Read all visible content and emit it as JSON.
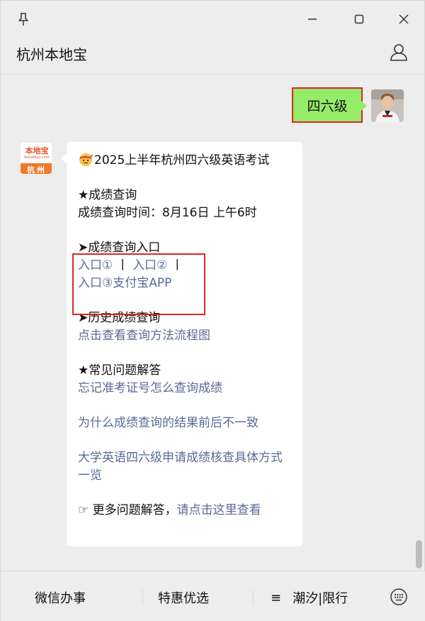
{
  "window": {
    "title": "杭州本地宝"
  },
  "header": {
    "title": "杭州本地宝",
    "profile_icon": "person-icon"
  },
  "chat": {
    "sent_message": "四六级",
    "bot_avatar": {
      "logo_text": "本地宝",
      "logo_url": "bendibao.com",
      "city": "杭州"
    },
    "reply": {
      "title_emoji": "face-with-headband-emoji",
      "title": "2025上半年杭州四六级英语考试",
      "score_heading": "★成绩查询",
      "score_time": "成绩查询时间：8月16日 上午6时",
      "entry_heading": "➤成绩查询入口",
      "entry_1": "入口①",
      "separator": "丨",
      "entry_2": "入口②",
      "separator_2": "丨",
      "entry_3": "入口③支付宝APP",
      "history_heading": "➤历史成绩查询",
      "history_link": "点击查看查询方法流程图",
      "faq_heading": "★常见问题解答",
      "faq_1": "忘记准考证号怎么查询成绩",
      "faq_2": "为什么成绩查询的结果前后不一致",
      "faq_3": "大学英语四六级申请成绩核查具体方式一览",
      "more_prefix": "☞ 更多问题解答，",
      "more_link": "请点击这里查看"
    }
  },
  "menu": {
    "item_1": "微信办事",
    "item_2": "特惠优选",
    "item_3": "潮汐|限行",
    "list_icon": "≡"
  },
  "colors": {
    "background": "#ededed",
    "sent_bubble": "#95ec69",
    "link": "#576b95",
    "highlight": "#e02424",
    "logo_orange": "#f07a2c"
  }
}
